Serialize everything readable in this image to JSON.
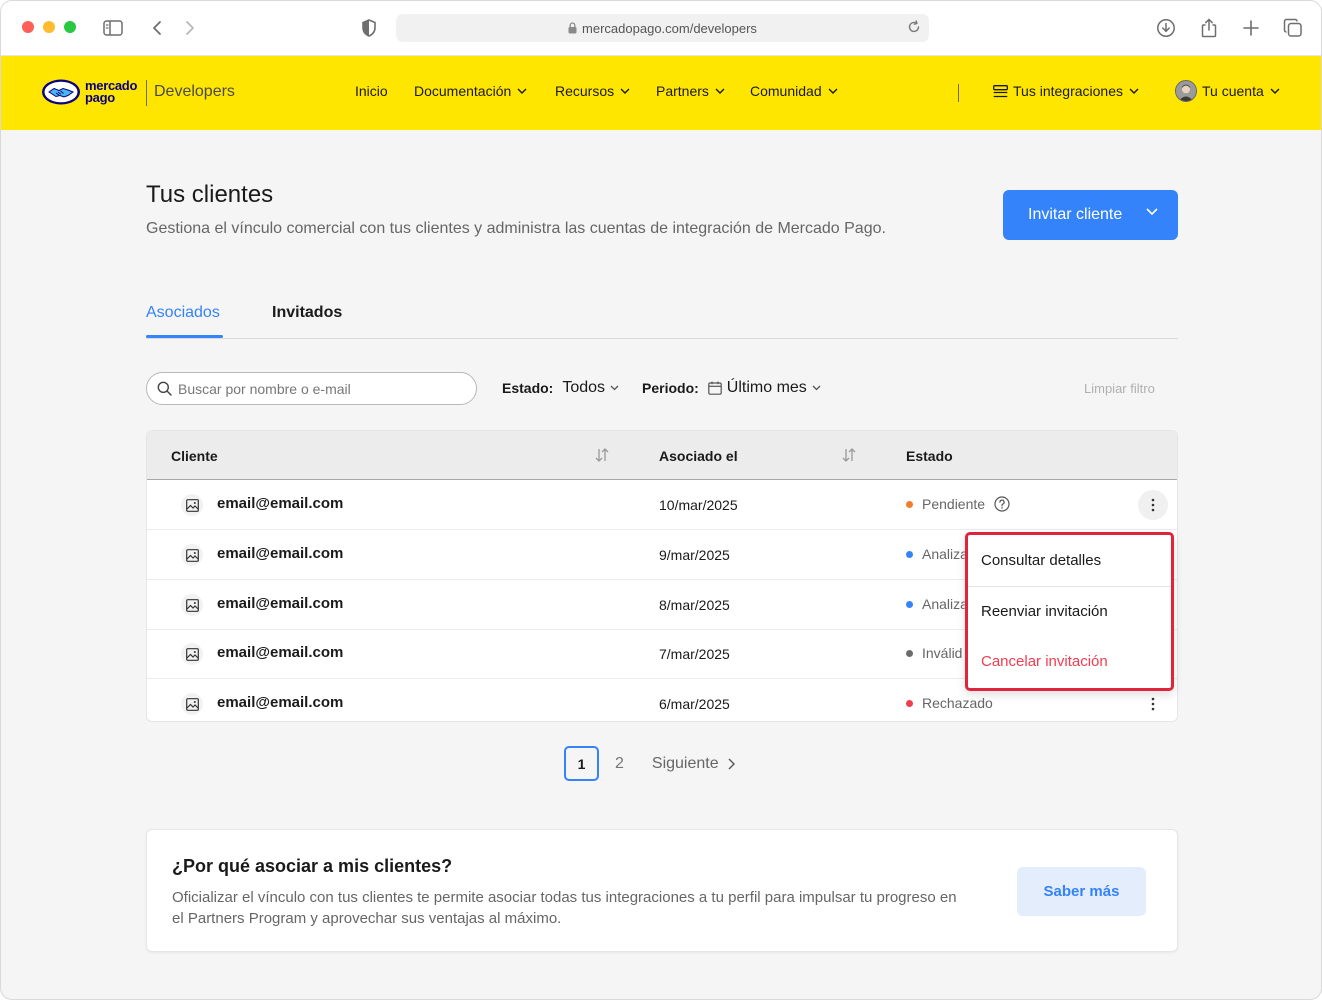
{
  "browser": {
    "url": "mercadopago.com/developers"
  },
  "header": {
    "logo_line1": "mercado",
    "logo_line2": "pago",
    "product": "Developers",
    "nav": {
      "inicio": "Inicio",
      "documentacion": "Documentación",
      "recursos": "Recursos",
      "partners": "Partners",
      "comunidad": "Comunidad"
    },
    "integraciones": "Tus integraciones",
    "cuenta": "Tu cuenta"
  },
  "main": {
    "title": "Tus clientes",
    "subtitle": "Gestiona el vínculo comercial con tus clientes y administra las cuentas de integración de Mercado Pago.",
    "invite_button": "Invitar cliente",
    "tabs": {
      "asociados": "Asociados",
      "invitados": "Invitados"
    },
    "search_placeholder": "Buscar por nombre o e-mail",
    "filters": {
      "estado_label": "Estado:",
      "estado_value": "Todos",
      "periodo_label": "Periodo:",
      "periodo_value": "Último mes",
      "clear": "Limpiar filtro"
    }
  },
  "table": {
    "headers": {
      "cliente": "Cliente",
      "asociado": "Asociado el",
      "estado": "Estado"
    },
    "rows": [
      {
        "email": "email@email.com",
        "date": "10/mar/2025",
        "status": "Pendiente"
      },
      {
        "email": "email@email.com",
        "date": "9/mar/2025",
        "status": "Analiza"
      },
      {
        "email": "email@email.com",
        "date": "8/mar/2025",
        "status": "Analiza"
      },
      {
        "email": "email@email.com",
        "date": "7/mar/2025",
        "status": "Inválid"
      },
      {
        "email": "email@email.com",
        "date": "6/mar/2025",
        "status": "Rechazado"
      }
    ]
  },
  "row_menu": {
    "details": "Consultar detalles",
    "resend": "Reenviar invitación",
    "cancel": "Cancelar invitación"
  },
  "pagination": {
    "current": "1",
    "page2": "2",
    "next": "Siguiente"
  },
  "info_card": {
    "title": "¿Por qué asociar a mis clientes?",
    "text": "Oficializar el vínculo con tus clientes te permite asociar todas tus integraciones a tu perfil para impulsar tu progreso en el Partners Program y aprovechar sus ventajas al máximo.",
    "button": "Saber más"
  },
  "colors": {
    "brand_yellow": "#ffe600",
    "primary_blue": "#3483fa",
    "status_pending": "#f57c2b",
    "status_analyzing": "#3483fa",
    "status_invalid": "#6b6b6b",
    "status_rejected": "#f23d4f",
    "menu_highlight": "#e0243d"
  }
}
